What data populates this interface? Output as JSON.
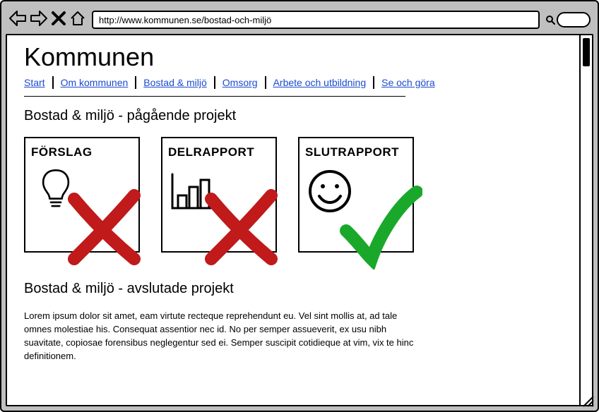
{
  "browser": {
    "url": "http://www.kommunen.se/bostad-och-miljö"
  },
  "site": {
    "title": "Kommunen"
  },
  "nav": {
    "items": [
      {
        "label": "Start"
      },
      {
        "label": "Om kommunen"
      },
      {
        "label": "Bostad & miljö"
      },
      {
        "label": "Omsorg"
      },
      {
        "label": "Arbete och utbildning"
      },
      {
        "label": "Se och göra"
      }
    ]
  },
  "section_ongoing": {
    "heading": "Bostad & miljö - pågående projekt",
    "cards": [
      {
        "title": "FÖRSLAG",
        "icon": "lightbulb",
        "status": "rejected"
      },
      {
        "title": "DELRAPPORT",
        "icon": "barchart",
        "status": "rejected"
      },
      {
        "title": "SLUTRAPPORT",
        "icon": "smiley",
        "status": "approved"
      }
    ]
  },
  "section_completed": {
    "heading": "Bostad & miljö - avslutade projekt",
    "body": "Lorem ipsum dolor sit amet, eam virtute recteque reprehendunt eu. Vel sint mollis at, ad tale omnes molestiae his. Consequat assentior nec id. No per semper assueverit, ex usu nibh suavitate, copiosae forensibus neglegentur sed ei. Semper suscipit cotidieque at vim, vix te hinc definitionem."
  }
}
